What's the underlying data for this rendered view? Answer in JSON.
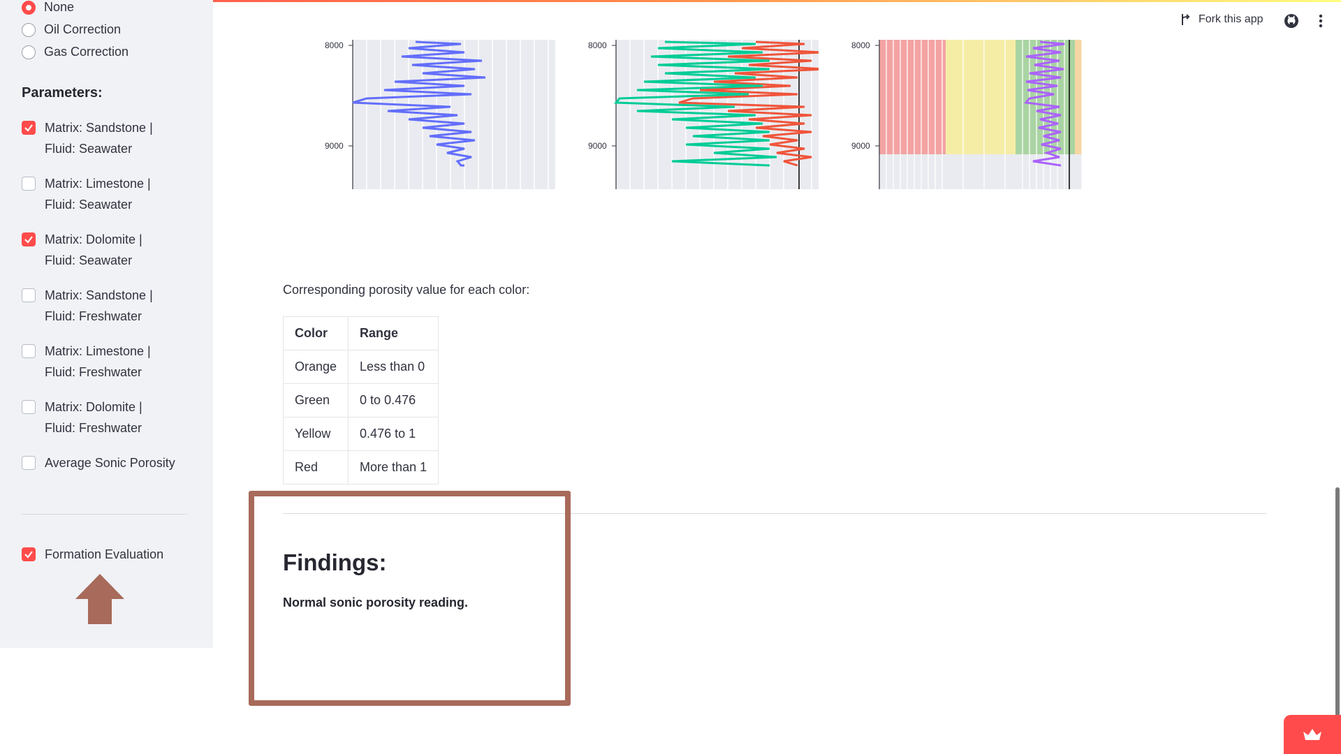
{
  "sidebar": {
    "radios": [
      {
        "label": "None",
        "checked": true
      },
      {
        "label": "Oil Correction",
        "checked": false
      },
      {
        "label": "Gas Correction",
        "checked": false
      }
    ],
    "parameters_title": "Parameters:",
    "checkboxes": [
      {
        "line1": "Matrix: Sandstone |",
        "line2": "Fluid: Seawater",
        "checked": true
      },
      {
        "line1": "Matrix: Limestone |",
        "line2": "Fluid: Seawater",
        "checked": false
      },
      {
        "line1": "Matrix: Dolomite |",
        "line2": "Fluid: Seawater",
        "checked": true
      },
      {
        "line1": "Matrix: Sandstone |",
        "line2": "Fluid: Freshwater",
        "checked": false
      },
      {
        "line1": "Matrix: Limestone |",
        "line2": "Fluid: Freshwater",
        "checked": false
      },
      {
        "line1": "Matrix: Dolomite |",
        "line2": "Fluid: Freshwater",
        "checked": false
      },
      {
        "line1": "Average Sonic Porosity",
        "line2": "",
        "checked": false
      }
    ],
    "formation_eval": {
      "label": "Formation Evaluation",
      "checked": true
    }
  },
  "header": {
    "fork_label": "Fork this app"
  },
  "charts": {
    "y_ticks": [
      "8000",
      "9000"
    ],
    "colors": {
      "blue": "#636efa",
      "green": "#00cc96",
      "red": "#ef553b",
      "purple": "#ab63fa",
      "band_red": "#f4a3a3",
      "band_yellow": "#f5eda6",
      "band_green": "#a9d4a2",
      "band_orange": "#f6d6a2"
    }
  },
  "content": {
    "caption": "Corresponding porosity value for each color:",
    "table": {
      "headers": [
        "Color",
        "Range"
      ],
      "rows": [
        [
          "Orange",
          "Less than 0"
        ],
        [
          "Green",
          "0 to 0.476"
        ],
        [
          "Yellow",
          "0.476 to 1"
        ],
        [
          "Red",
          "More than 1"
        ]
      ]
    },
    "findings_title": "Findings:",
    "findings_text": "Normal sonic porosity reading."
  },
  "colors": {
    "accent": "#ff4b4b",
    "highlight": "#a86a5a",
    "sidebar_bg": "#f0f2f6"
  }
}
